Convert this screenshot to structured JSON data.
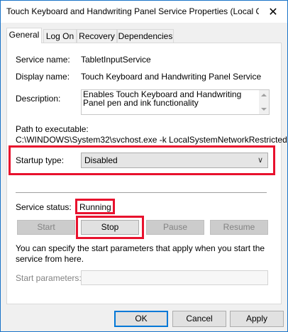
{
  "window": {
    "title": "Touch Keyboard and Handwriting Panel Service Properties (Local C...",
    "close_glyph": "✕"
  },
  "tabs": [
    "General",
    "Log On",
    "Recovery",
    "Dependencies"
  ],
  "general": {
    "service_name_label": "Service name:",
    "service_name_value": "TabletInputService",
    "display_name_label": "Display name:",
    "display_name_value": "Touch Keyboard and Handwriting Panel Service",
    "description_label": "Description:",
    "description_value": "Enables Touch Keyboard and Handwriting Panel pen and ink functionality",
    "path_label": "Path to executable:",
    "path_value": "C:\\WINDOWS\\System32\\svchost.exe -k LocalSystemNetworkRestricted",
    "startup_type_label": "Startup type:",
    "startup_type_value": "Disabled",
    "service_status_label": "Service status:",
    "service_status_value": "Running",
    "buttons": {
      "start": "Start",
      "stop": "Stop",
      "pause": "Pause",
      "resume": "Resume"
    },
    "hint": "You can specify the start parameters that apply when you start the service from here.",
    "start_params_label": "Start parameters:",
    "start_params_value": ""
  },
  "footer": {
    "ok": "OK",
    "cancel": "Cancel",
    "apply": "Apply"
  },
  "colors": {
    "highlight": "#e8112d",
    "accent": "#0078d7"
  }
}
